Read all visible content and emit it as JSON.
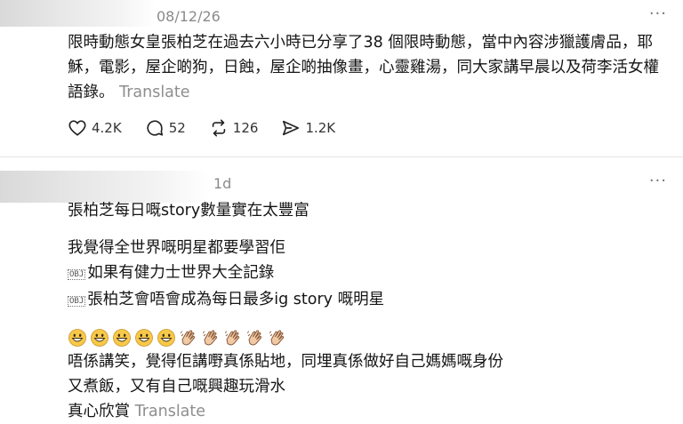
{
  "post1": {
    "timestamp": "08/12/26",
    "text": "限時動態女皇張柏芝在過去六小時已分享了38 個限時動態，當中內容涉獵護膚品，耶穌，電影，屋企啲狗，日蝕，屋企啲抽像畫，心靈雞湯，同大家講早晨以及荷李活女權語錄。",
    "translate_label": "Translate",
    "actions": {
      "like_count": "4.2K",
      "reply_count": "52",
      "repost_count": "126",
      "share_count": "1.2K"
    }
  },
  "post2": {
    "timestamp": "1d",
    "line1": "張柏芝每日嘅story數量實在太豐富",
    "line2": "我覺得全世界嘅明星都要學習佢",
    "line3_ctrl": "OBJ",
    "line3": "如果有健力士世界大全記錄",
    "line4_ctrl": "OBJ",
    "line4": "張柏芝會唔會成為每日最多ig story 嘅明星",
    "emoji_names": [
      "grinning-face",
      "grinning-face",
      "grinning-face",
      "grinning-face",
      "grinning-face",
      "clapping-hands",
      "clapping-hands",
      "clapping-hands",
      "clapping-hands",
      "clapping-hands"
    ],
    "line5": "唔係講笑，覺得佢講嘢真係貼地，同埋真係做好自己媽媽嘅身份",
    "line6": "又煮飯，又有自己嘅興趣玩滑水",
    "line7": "真心欣賞",
    "translate_label": "Translate"
  },
  "more_label": "···",
  "colors": {
    "emoji_face": "#f7c948",
    "emoji_hand": "#f1c9a5",
    "muted": "#8e8e8e"
  }
}
